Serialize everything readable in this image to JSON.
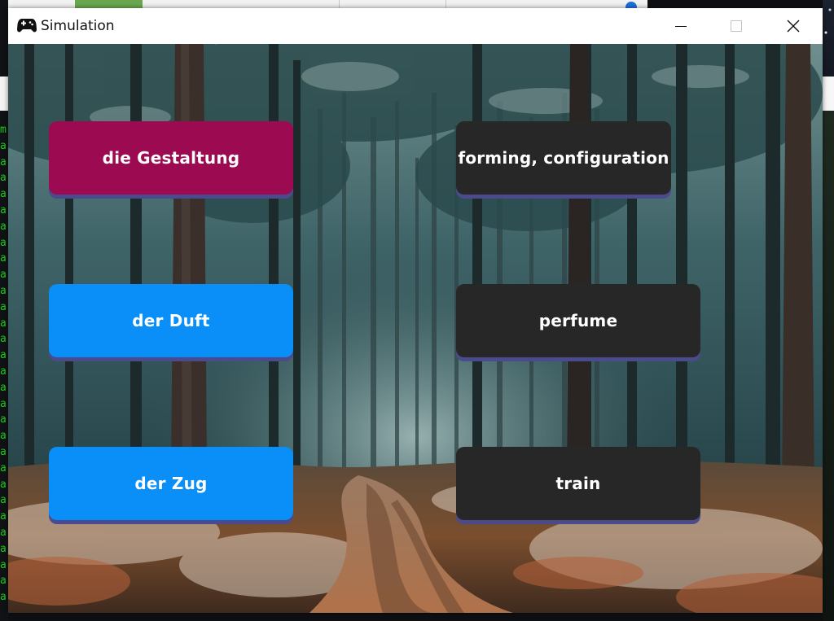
{
  "window": {
    "title": "Simulation",
    "icon": "gamepad-icon",
    "controls": [
      "minimize-icon",
      "maximize-icon",
      "close-icon"
    ]
  },
  "game": {
    "left_column": [
      {
        "label": "die Gestaltung",
        "state": "selected",
        "color": "#9c0a51"
      },
      {
        "label": "der Duft",
        "state": "idle",
        "color": "#0a8ef7"
      },
      {
        "label": "der Zug",
        "state": "idle",
        "color": "#0a8ef7"
      }
    ],
    "right_column": [
      {
        "label": "forming, configuration",
        "color": "#272727"
      },
      {
        "label": "perfume",
        "color": "#272727"
      },
      {
        "label": "train",
        "color": "#272727"
      }
    ],
    "card_shadow_color": "#4a4a8c"
  },
  "background_desktop": {
    "terminal_glyphs": "m\na\na\na\na\na\na\na\na\na\na\na\na\na\na\na\na\na\na\na\na\na\na\na\na\na\na\na\na\na"
  }
}
